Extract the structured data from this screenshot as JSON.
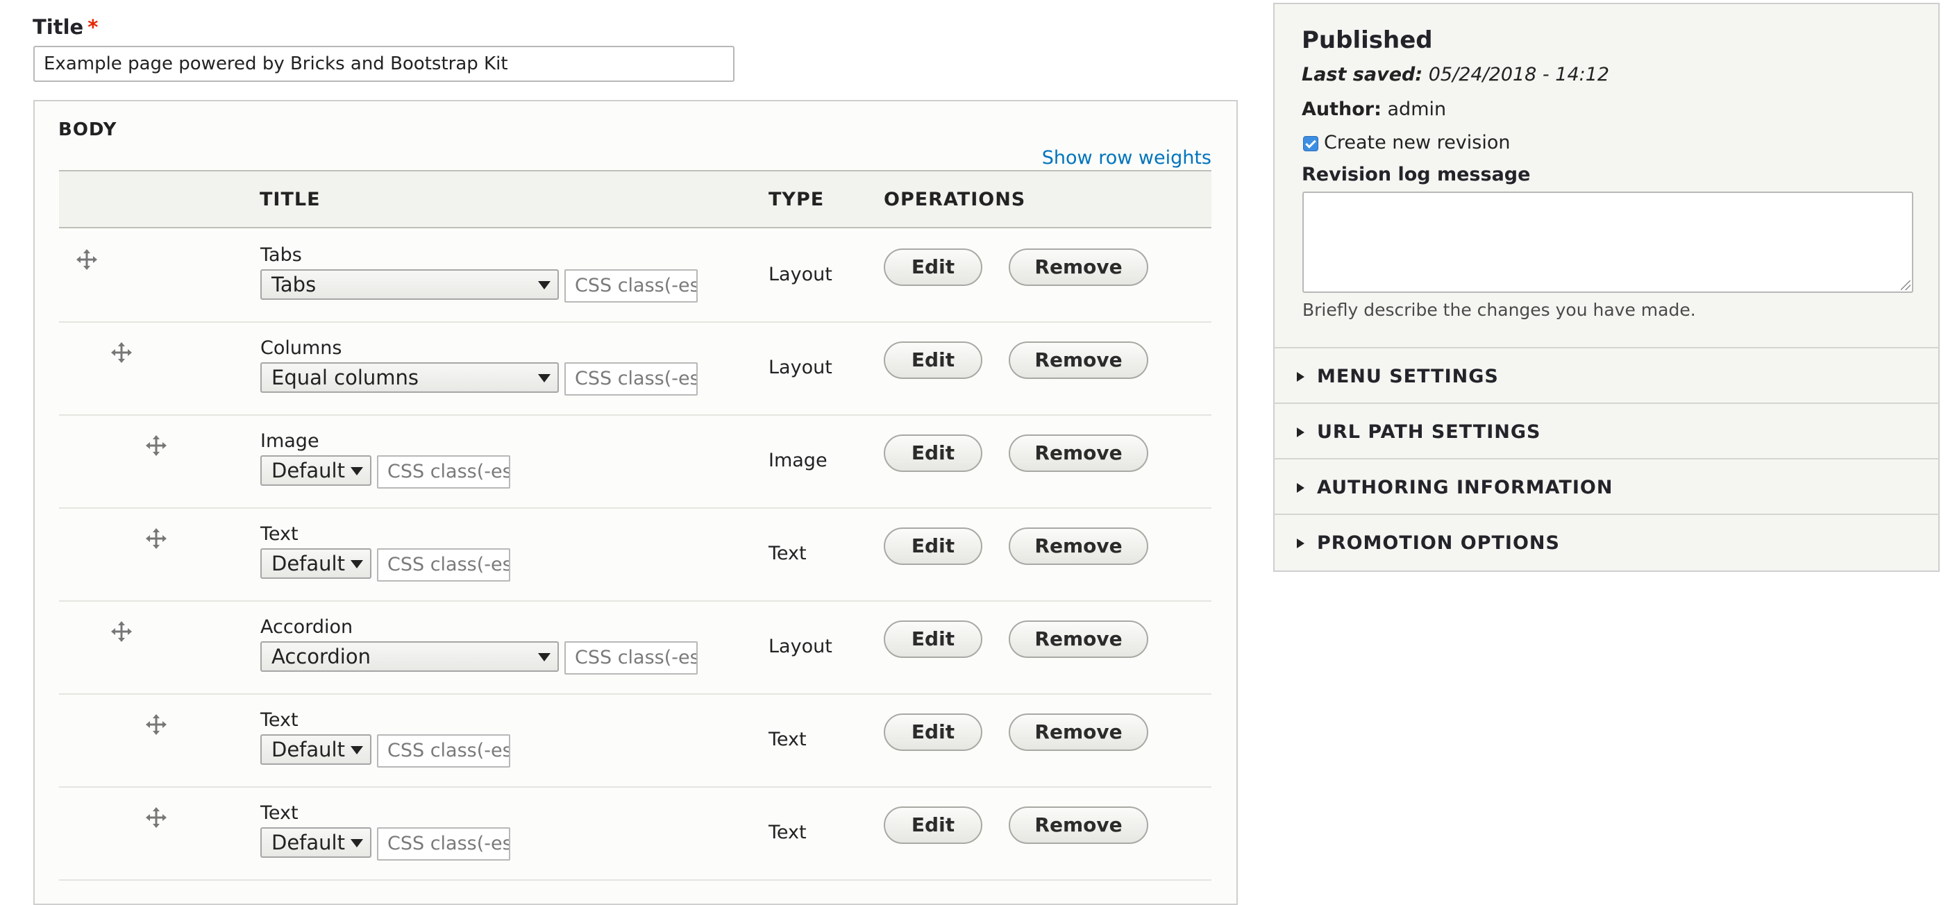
{
  "title_field": {
    "label": "Title",
    "required_mark": "*",
    "value": "Example page powered by Bricks and Bootstrap Kit"
  },
  "body": {
    "legend": "BODY",
    "show_row_weights": "Show row weights",
    "columns": [
      "TITLE",
      "TYPE",
      "OPERATIONS"
    ],
    "css_placeholder": "CSS class(-es",
    "edit_label": "Edit",
    "remove_label": "Remove",
    "rows": [
      {
        "title": "Tabs",
        "select": "Tabs",
        "type": "Layout",
        "depth": 0
      },
      {
        "title": "Columns",
        "select": "Equal columns",
        "type": "Layout",
        "depth": 1
      },
      {
        "title": "Image",
        "select": "Default",
        "type": "Image",
        "depth": 2
      },
      {
        "title": "Text",
        "select": "Default",
        "type": "Text",
        "depth": 2
      },
      {
        "title": "Accordion",
        "select": "Accordion",
        "type": "Layout",
        "depth": 1
      },
      {
        "title": "Text",
        "select": "Default",
        "type": "Text",
        "depth": 2
      },
      {
        "title": "Text",
        "select": "Default",
        "type": "Text",
        "depth": 2
      }
    ]
  },
  "sidebar": {
    "status": "Published",
    "last_saved_label": "Last saved:",
    "last_saved_value": "05/24/2018 - 14:12",
    "author_label": "Author:",
    "author_value": "admin",
    "create_revision_label": "Create new revision",
    "create_revision_checked": true,
    "revision_log_label": "Revision log message",
    "revision_log_value": "",
    "revision_log_description": "Briefly describe the changes you have made.",
    "sections": [
      "MENU SETTINGS",
      "URL PATH SETTINGS",
      "AUTHORING INFORMATION",
      "PROMOTION OPTIONS"
    ]
  },
  "colors": {
    "link": "#0074bd",
    "required": "#e62600",
    "checkbox": "#3d8ee2"
  }
}
